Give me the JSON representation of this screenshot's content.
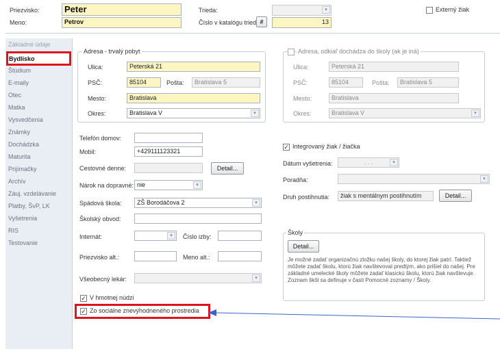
{
  "header": {
    "surname_label": "Priezvisko:",
    "surname_value": "Peter",
    "name_label": "Meno:",
    "name_value": "Petrov",
    "class_label": "Trieda:",
    "catalog_label": "Číslo v katalógu triedy:",
    "catalog_hash": "#",
    "catalog_value": "13",
    "external_label": "Externý žiak"
  },
  "sidebar": {
    "items": [
      {
        "label": "Základné údaje"
      },
      {
        "label": "Bydlisko"
      },
      {
        "label": "Štúdium"
      },
      {
        "label": "E-maily"
      },
      {
        "label": "Otec"
      },
      {
        "label": "Matka"
      },
      {
        "label": "Vysvedčenia"
      },
      {
        "label": "Známky"
      },
      {
        "label": "Dochádzka"
      },
      {
        "label": "Maturita"
      },
      {
        "label": "Prijímačky"
      },
      {
        "label": "Archív"
      },
      {
        "label": "Záuj. vzdelávanie"
      },
      {
        "label": "Platby, ŠvP, LK"
      },
      {
        "label": "Vyšetrenia"
      },
      {
        "label": "RIS"
      },
      {
        "label": "Testovanie"
      }
    ]
  },
  "address": {
    "title": "Adresa - trvalý pobyt",
    "street_label": "Ulica:",
    "street_value": "Peterská 21",
    "zip_label": "PSČ:",
    "zip_value": "85104",
    "post_label": "Pošta:",
    "post_value": "Bratislava 5",
    "city_label": "Mesto:",
    "city_value": "Bratislava",
    "district_label": "Okres:",
    "district_value": "Bratislava V"
  },
  "address2": {
    "title": "Adresa, odkiaľ dochádza do školy (ak je iná)",
    "street_label": "Ulica:",
    "street_value": "Peterská 21",
    "zip_label": "PSČ:",
    "zip_value": "85104",
    "post_label": "Pošta:",
    "post_value": "Bratislava 5",
    "city_label": "Mesto:",
    "city_value": "Bratislava",
    "district_label": "Okres:",
    "district_value": "Bratislava V"
  },
  "contact": {
    "phone_home_label": "Telefón domov:",
    "phone_home_value": "",
    "mobile_label": "Mobil:",
    "mobile_value": "+429111123321",
    "travel_label": "Cestovné denne:",
    "detail_label": "Detail...",
    "transport_label": "Nárok na dopravné:",
    "transport_value": "nie",
    "school_label": "Spádová škola:",
    "school_value": "ZŠ Borodáčova 2",
    "district_label": "Školský obvod:",
    "boarding_label": "Internát:",
    "room_label": "Číslo izby:",
    "surname_alt_label": "Priezvisko alt.:",
    "name_alt_label": "Meno alt.:",
    "doctor_label": "Všeobecný lekár:",
    "material_need_label": "V hmotnej núdzi",
    "social_label": "Zo sociálne znevýhodneného prostredia"
  },
  "integration": {
    "integrated_label": "Integrovaný žiak / žiačka",
    "exam_date_label": "Dátum vyšetrenia:",
    "exam_date_value": ". . .",
    "advisory_label": "Poradňa:",
    "disability_label": "Druh postihnutia:",
    "disability_value": "žiak s mentálnym postihnutím",
    "detail_label": "Detail..."
  },
  "schools": {
    "title": "Školy",
    "detail_label": "Detail...",
    "note": "Je možné zadať organizačnú zložku našej školy, do ktorej žiak patrí. Taktiež môžete zadať školu, ktorú žiak navštevoval predtým, ako prišiel do našej. Pre základné umelecké školy môžete zadať klasickú školu, ktorú žiak navštevuje. Zoznam škôl sa definuje v časti Pomocné zoznamy / Školy."
  },
  "colors": {
    "highlight_red": "#e0121b",
    "arrow_blue": "#3b63c8",
    "field_yellow": "#fdf6c3"
  }
}
